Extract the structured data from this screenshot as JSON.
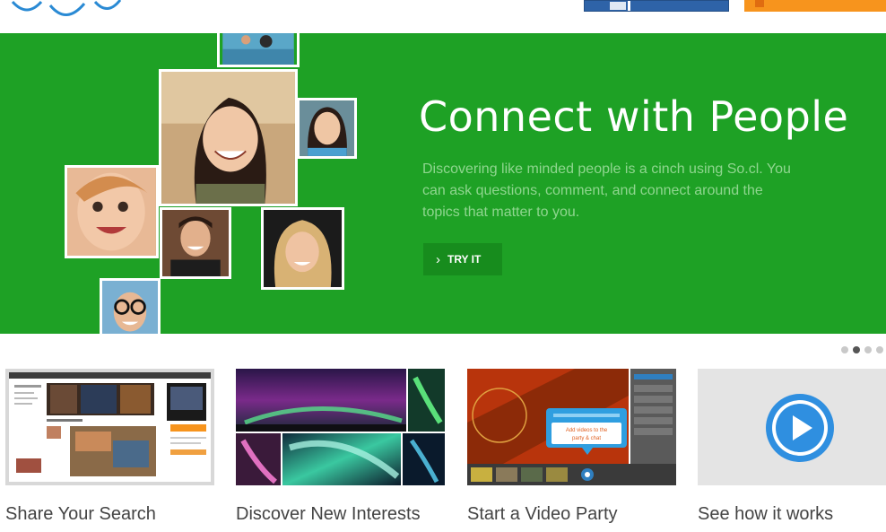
{
  "header": {
    "logo_icon": "logo-arc-icon",
    "colors": {
      "blue_button": "#2e63a8",
      "orange_button": "#f7941d"
    }
  },
  "hero": {
    "title": "Connect with People",
    "description": "Discovering like minded people is a cinch using So.cl. You can ask questions, comment, and connect around the topics that matter to you.",
    "cta_label": "TRY IT",
    "cta_icon": "chevron-right-icon",
    "background_color": "#1ea125"
  },
  "carousel": {
    "pages": 4,
    "active_page": 2
  },
  "tiles": [
    {
      "label": "Share Your Search"
    },
    {
      "label": "Discover New Interests"
    },
    {
      "label": "Start a Video Party"
    },
    {
      "label": "See how it works",
      "icon": "play-icon"
    }
  ],
  "video_party_popup": {
    "text": "Add videos to the party & chat"
  }
}
